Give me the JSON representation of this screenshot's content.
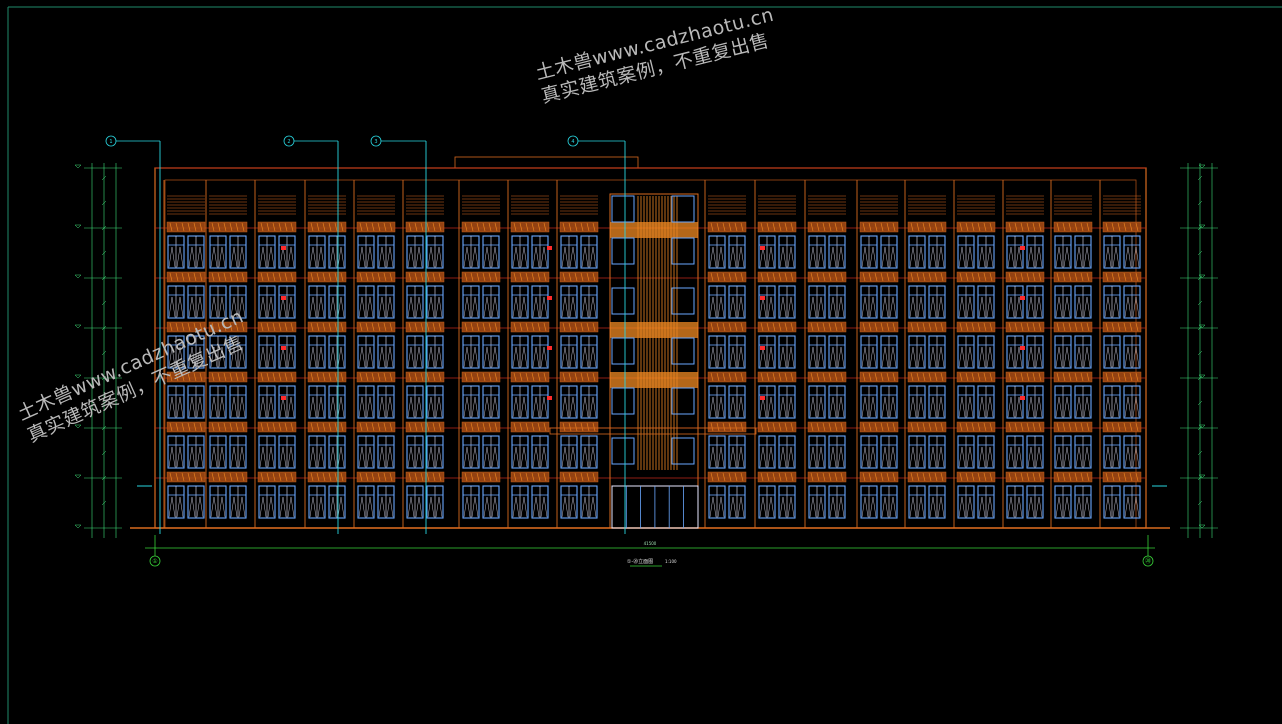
{
  "drawing": {
    "kind": "CAD building elevation",
    "floors": 7,
    "bays": 20,
    "colors": {
      "background": "#000000",
      "frame": "#1f8a6a",
      "facade": "#d86a1e",
      "facade_dark": "#a44a14",
      "accent_orange": "#f08a22",
      "glass": "#6aa8ff",
      "window_frame": "#e8e8ff",
      "axis": "#39d339",
      "leader": "#29d6e0",
      "marker": "#ff2b2b",
      "dim": "#3fe07a",
      "floor_line": "#c0281a"
    },
    "axis_labels": {
      "left": "①",
      "right": "⑳"
    },
    "callouts": [
      "1",
      "2",
      "3",
      "4"
    ],
    "caption": "①-⑳立面图",
    "caption_scale": "1:100",
    "overall_dimension": "41500"
  },
  "watermarks": {
    "top": {
      "line1": "土木兽www.cadzhaotu.cn",
      "line2": "真实建筑案例，不重复出售"
    },
    "left": {
      "line1": "土木兽www.cadzhaotu.cn",
      "line2": "真实建筑案例，不重复出售"
    }
  }
}
